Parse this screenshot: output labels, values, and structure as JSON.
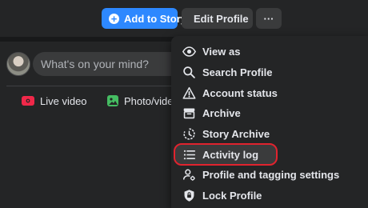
{
  "header": {
    "add_story_label": "Add to Story",
    "edit_profile_label": "Edit Profile",
    "more_label": "···"
  },
  "composer": {
    "placeholder": "What's on your mind?",
    "live_video_label": "Live video",
    "photo_video_label": "Photo/video"
  },
  "menu": {
    "items": [
      {
        "label": "View as",
        "icon": "eye-icon"
      },
      {
        "label": "Search Profile",
        "icon": "search-icon"
      },
      {
        "label": "Account status",
        "icon": "warning-icon"
      },
      {
        "label": "Archive",
        "icon": "archive-icon"
      },
      {
        "label": "Story Archive",
        "icon": "history-icon"
      },
      {
        "label": "Activity log",
        "icon": "list-icon",
        "highlighted": true
      },
      {
        "label": "Profile and tagging settings",
        "icon": "profile-settings-icon"
      },
      {
        "label": "Lock Profile",
        "icon": "shield-lock-icon"
      }
    ]
  },
  "colors": {
    "accent": "#2d88ff",
    "highlight_border": "#e0232e",
    "live_red": "#f02849",
    "photo_green": "#45bd62"
  }
}
